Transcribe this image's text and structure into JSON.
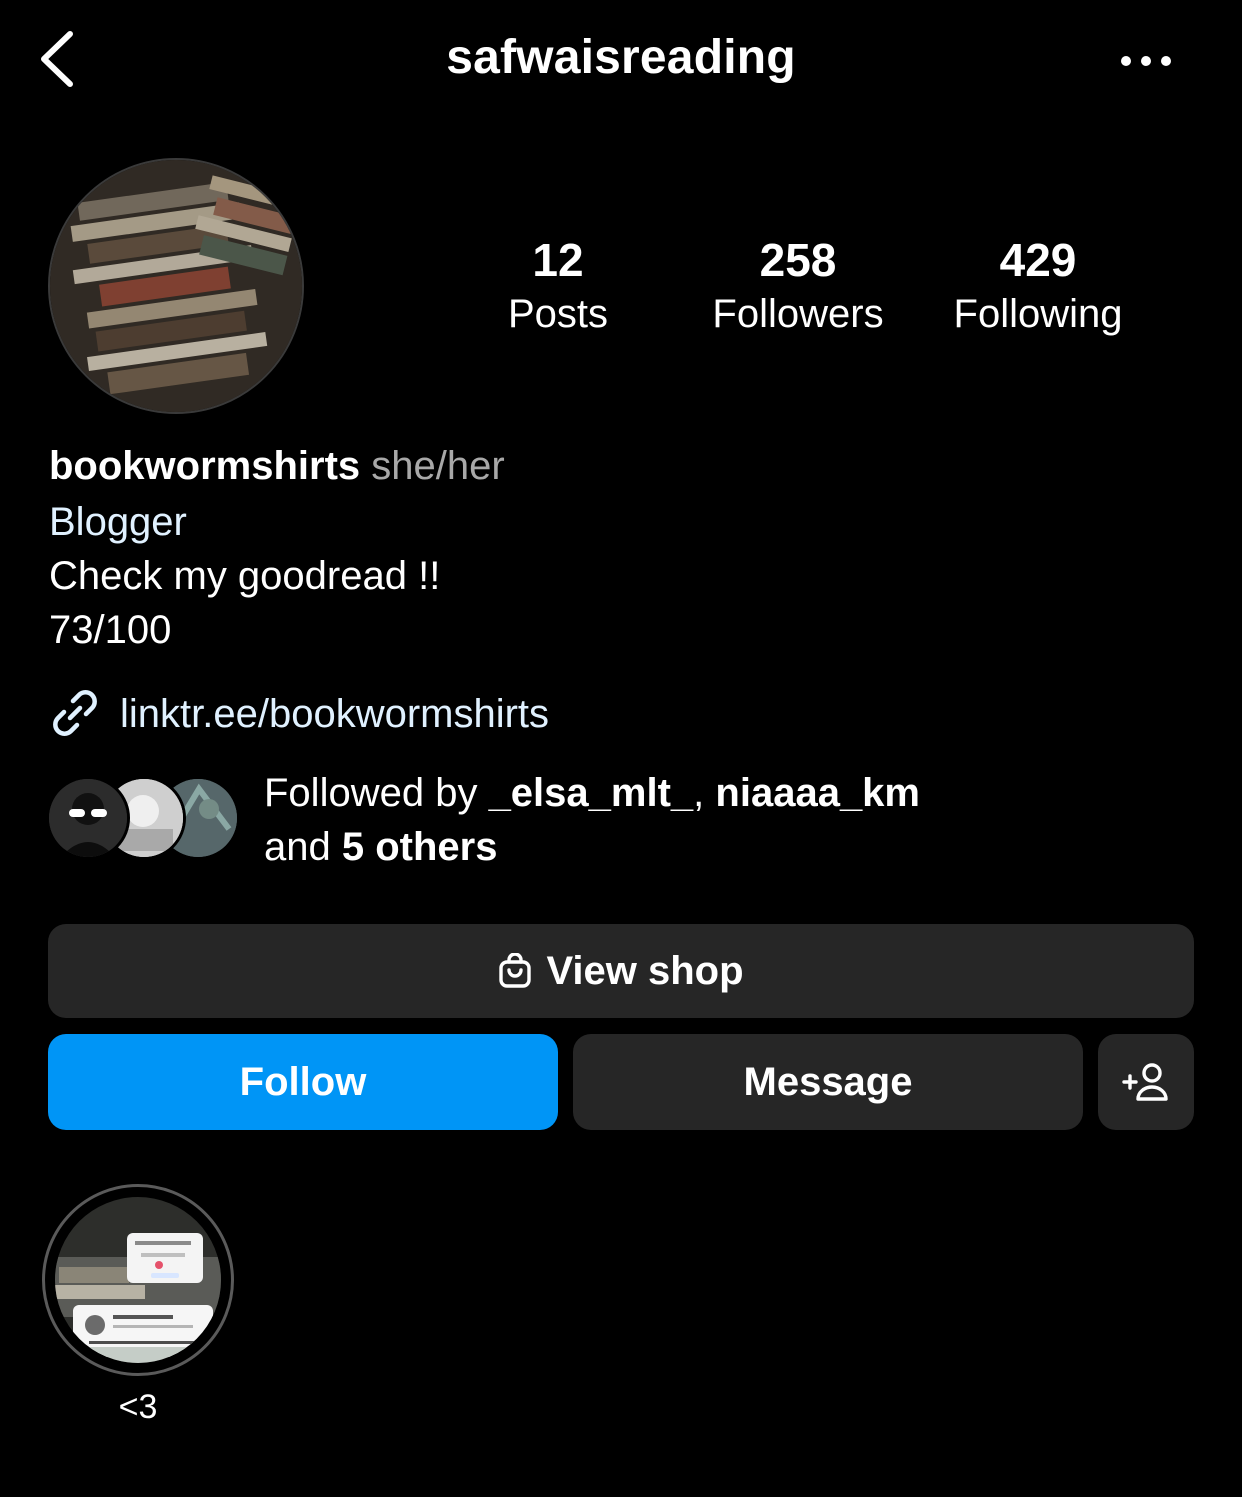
{
  "header": {
    "username": "safwaisreading"
  },
  "stats": [
    {
      "value": "12",
      "label": "Posts"
    },
    {
      "value": "258",
      "label": "Followers"
    },
    {
      "value": "429",
      "label": "Following"
    }
  ],
  "bio": {
    "name": "bookwormshirts",
    "pronouns": "she/her",
    "category": "Blogger",
    "line1": "Check my goodread !!",
    "line2": "73/100",
    "link": "linktr.ee/bookwormshirts"
  },
  "followed_by": {
    "prefix": "Followed by",
    "user1": "_elsa_mlt_",
    "separator": ",",
    "user2": "niaaaa_km",
    "and": "and",
    "others": "5 others"
  },
  "actions": {
    "view_shop": "View shop",
    "follow": "Follow",
    "message": "Message"
  },
  "highlights": [
    {
      "label": "<3"
    }
  ],
  "colors": {
    "background": "#000000",
    "follow_blue": "#0095f6",
    "button_dark": "#262626",
    "link_tint": "#e0f1ff"
  }
}
